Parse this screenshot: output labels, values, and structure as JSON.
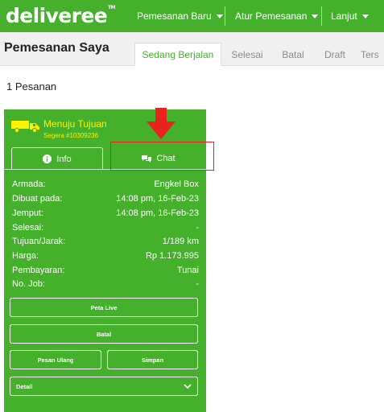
{
  "header": {
    "logo_text": "deliveree",
    "logo_tm": "TM",
    "nav": [
      {
        "label": "Pemesanan Baru"
      },
      {
        "label": "Atur Pemesanan"
      },
      {
        "label": "Lanjut"
      }
    ],
    "brand_color": "#45b02b"
  },
  "subheader": {
    "title": "Pemesanan Saya",
    "tabs": [
      {
        "label": "Sedang Berjalan",
        "active": true
      },
      {
        "label": "Selesai"
      },
      {
        "label": "Batal"
      },
      {
        "label": "Draft"
      },
      {
        "label": "Ters"
      }
    ]
  },
  "order_count": "1 Pesanan",
  "order_card": {
    "status": "Menuju Tujuan",
    "booking": "Segera #10309236",
    "status_color": "#fff200",
    "tabs": {
      "info": "Info",
      "chat": "Chat"
    },
    "details": [
      {
        "label": "Armada:",
        "value": "Engkel Box"
      },
      {
        "label": "Dibuat pada:",
        "value": "14:08 pm, 16-Feb-23"
      },
      {
        "label": "Jemput:",
        "value": "14:08 pm, 16-Feb-23"
      },
      {
        "label": "Selesai:",
        "value": "-"
      },
      {
        "label": "Tujuan/Jarak:",
        "value": "1/189 km"
      },
      {
        "label": "Harga:",
        "value": "Rp 1.173.995"
      },
      {
        "label": "Pembayaran:",
        "value": "Tunai"
      },
      {
        "label": "No. Job:",
        "value": "-"
      }
    ],
    "buttons": {
      "peta_live": "Peta Live",
      "batal": "Batal",
      "pesan_ulang": "Pesan Ulang",
      "simpan": "Simpan"
    },
    "detail_select": "Detail"
  },
  "annotation_color": "#e8231f"
}
